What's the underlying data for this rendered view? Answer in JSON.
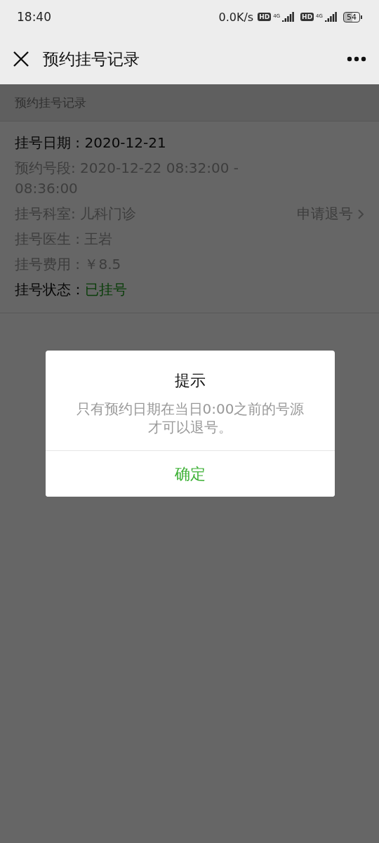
{
  "status_bar": {
    "time": "18:40",
    "net_speed": "0.0K/s",
    "sims": [
      {
        "hd": "HD",
        "network": "4G"
      },
      {
        "hd": "HD",
        "network": "4G"
      }
    ],
    "battery": "54"
  },
  "header": {
    "title": "预约挂号记录"
  },
  "section": {
    "title": "预约挂号记录"
  },
  "record": {
    "rows": [
      {
        "kind": "primary",
        "text": "挂号日期 : 2020-12-21"
      },
      {
        "kind": "secondary",
        "text": "预约号段: 2020-12-22 08:32:00 - 08:36:00"
      },
      {
        "kind": "secondary",
        "text": "挂号科室: 儿科门诊",
        "action": "申请退号"
      },
      {
        "kind": "secondary",
        "text": "挂号医生 : 王岩"
      },
      {
        "kind": "secondary",
        "text": "挂号费用 : ￥8.5"
      },
      {
        "kind": "status",
        "text": "挂号状态：",
        "value": "已挂号"
      }
    ]
  },
  "dialog": {
    "title": "提示",
    "message": "只有预约日期在当日0:00之前的号源才可以退号。",
    "button": "确定"
  }
}
